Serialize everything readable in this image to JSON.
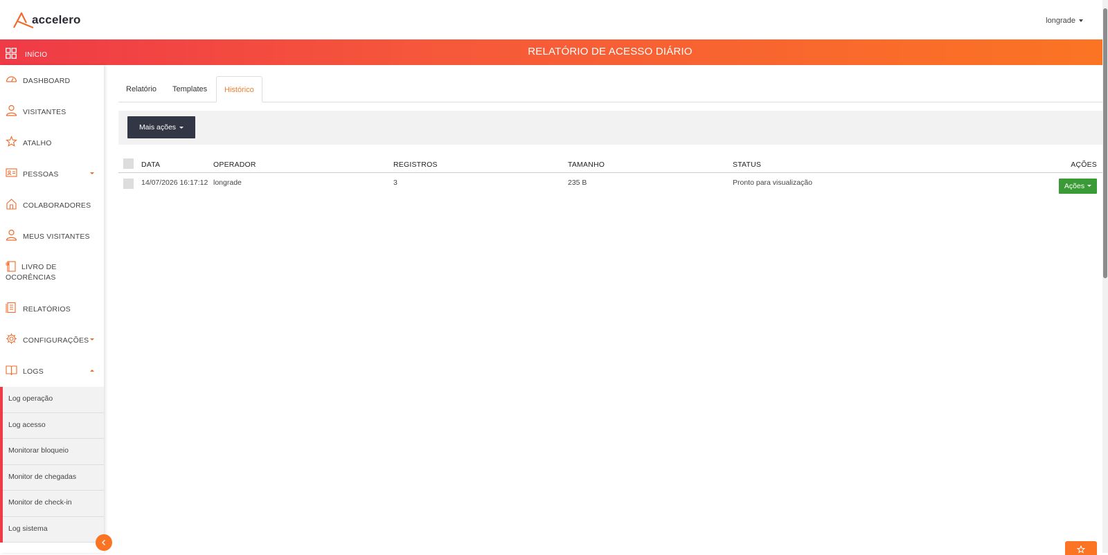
{
  "header": {
    "logo_text": "accelero",
    "user_name": "longrade"
  },
  "banner": {
    "home_label": "INÍCIO",
    "page_title": "RELATÓRIO DE ACESSO DIÁRIO"
  },
  "sidebar": {
    "items": [
      {
        "label": "DASHBOARD",
        "icon": "dashboard-icon"
      },
      {
        "label": "VISITANTES",
        "icon": "person-icon"
      },
      {
        "label": "ATALHO",
        "icon": "star-icon"
      },
      {
        "label": "PESSOAS",
        "icon": "id-card-icon"
      },
      {
        "label": "COLABORADORES",
        "icon": "home-icon"
      },
      {
        "label": "MEUS VISITANTES",
        "icon": "person-icon"
      },
      {
        "label": "LIVRO DE OCORÊNCIAS",
        "icon": "book-icon"
      },
      {
        "label": "RELATÓRIOS",
        "icon": "report-icon"
      },
      {
        "label": "CONFIGURAÇÕES",
        "icon": "gear-icon"
      },
      {
        "label": "LOGS",
        "icon": "open-book-icon"
      }
    ],
    "logs_sub": [
      "Log operação",
      "Log acesso",
      "Monitorar bloqueio",
      "Monitor de chegadas",
      "Monitor de check-in",
      "Log sistema"
    ]
  },
  "tabs": [
    "Relatório",
    "Templates",
    "Histórico"
  ],
  "toolbar": {
    "more_actions": "Mais ações"
  },
  "table": {
    "headers": [
      "DATA",
      "OPERADOR",
      "REGISTROS",
      "TAMANHO",
      "STATUS",
      "AÇÕES"
    ],
    "rows": [
      {
        "data": "14/07/2026 16:17:12",
        "operador": "longrade",
        "registros": "3",
        "tamanho": "235 B",
        "status": "Pronto para visualização",
        "acoes": "Ações"
      }
    ]
  },
  "colors": {
    "accent": "#fb7423",
    "accent_red": "#ef3a47",
    "dark_button": "#333645",
    "green_button": "#3a9a35"
  }
}
